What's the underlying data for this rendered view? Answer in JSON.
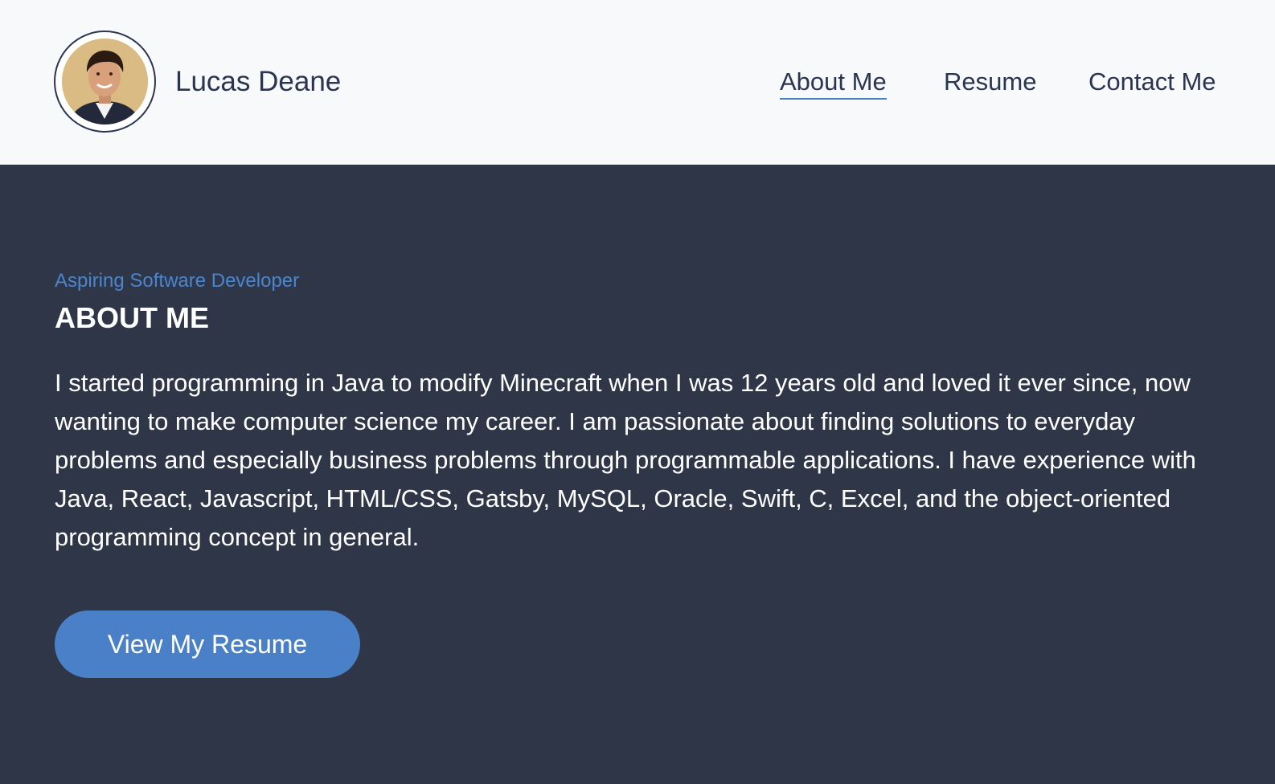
{
  "header": {
    "name": "Lucas Deane",
    "nav": [
      {
        "label": "About Me",
        "active": true
      },
      {
        "label": "Resume",
        "active": false
      },
      {
        "label": "Contact Me",
        "active": false
      }
    ]
  },
  "about": {
    "subtitle": "Aspiring Software Developer",
    "title": "ABOUT ME",
    "body": "I started programming in Java to modify Minecraft when I was 12 years old and loved it ever since, now wanting to make computer science my career. I am passionate about finding solutions to everyday problems and especially business problems through programmable applications. I have experience with Java, React, Javascript, HTML/CSS, Gatsby, MySQL, Oracle, Swift, C, Excel, and the object-oriented programming concept in general.",
    "button_label": "View My Resume"
  },
  "colors": {
    "header_bg": "#f7f9fb",
    "main_bg": "#2f3648",
    "accent": "#4a80c8",
    "nav_text": "#2b3550"
  },
  "icons": {
    "avatar": "profile-photo"
  }
}
